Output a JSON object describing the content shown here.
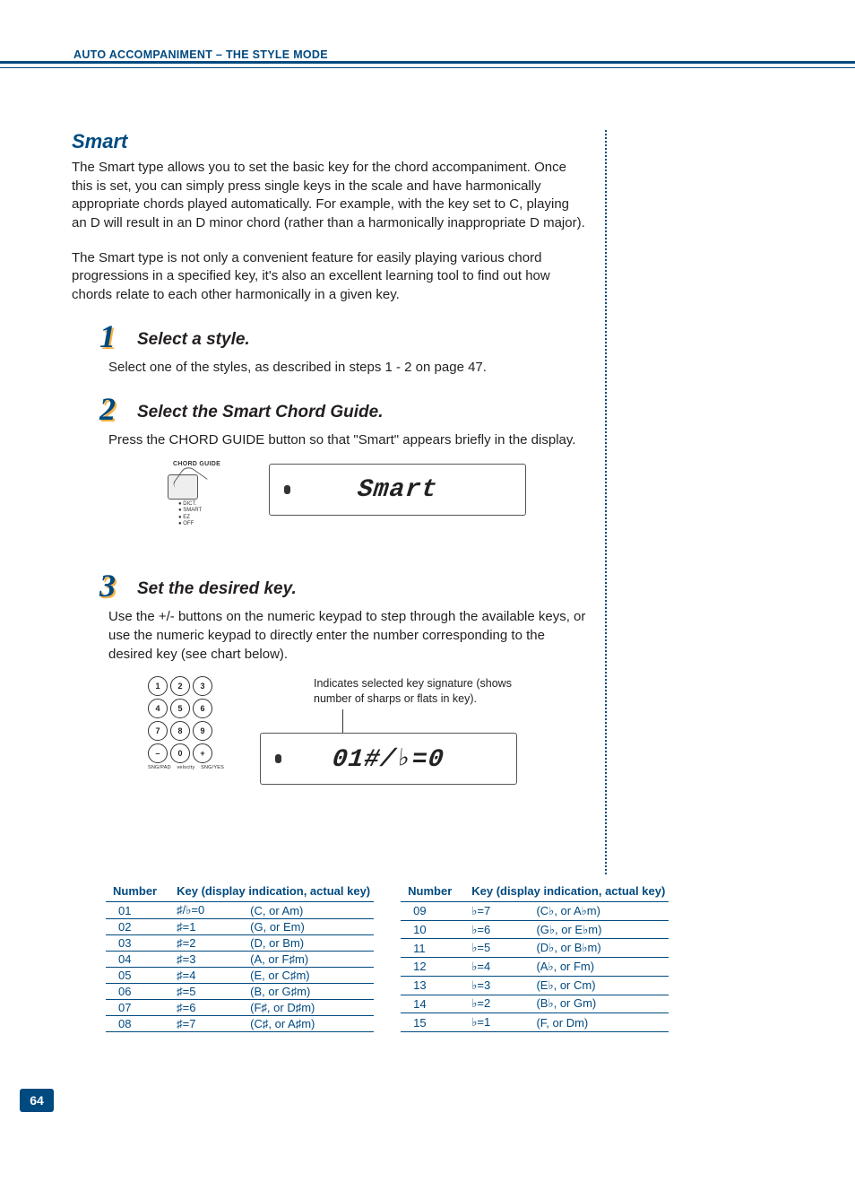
{
  "running_head": "AUTO ACCOMPANIMENT – THE STYLE MODE",
  "section_title": "Smart",
  "para1": "The Smart type allows you to set the basic key for the chord accompaniment.  Once this is set, you can simply press single keys in the scale and have harmonically appropriate chords played automatically.  For example, with the key set to C, playing an D will result in an D minor chord (rather than a harmonically inappropriate D major).",
  "para2": "The Smart type is not only a convenient feature for easily playing various chord progressions in a specified key, it's also an excellent learning tool to find out how chords relate to each other harmonically in a given key.",
  "steps": [
    {
      "num": "1",
      "title": "Select a style.",
      "body": "Select one of the styles, as described in steps 1 - 2 on page 47."
    },
    {
      "num": "2",
      "title": "Select the Smart Chord Guide.",
      "body": "Press the CHORD GUIDE button so that \"Smart\" appears briefly in the display."
    },
    {
      "num": "3",
      "title": "Set the desired key.",
      "body": "Use the +/- buttons on the numeric keypad to step through the available keys, or use the numeric keypad to directly enter the number corresponding to the desired key (see chart below)."
    }
  ],
  "chord_guide_btn": {
    "label": "CHORD GUIDE",
    "legend": [
      "DICT.",
      "SMART",
      "EZ",
      "OFF"
    ]
  },
  "lcd1": "Smart",
  "lcd2": "01#/♭=0",
  "keypad": {
    "keys": [
      "1",
      "2",
      "3",
      "4",
      "5",
      "6",
      "7",
      "8",
      "9",
      "–",
      "0",
      "+"
    ],
    "bottom_labels": [
      "SNG/PAD",
      "velocity",
      "SNG/YES"
    ]
  },
  "note_text": "Indicates selected key signature (shows number of sharps or flats in key).",
  "table_headers": {
    "number": "Number",
    "key": "Key (display indication, actual key)"
  },
  "table_left": [
    {
      "n": "01",
      "ind": "♯/♭=0",
      "act": "(C, or Am)"
    },
    {
      "n": "02",
      "ind": "♯=1",
      "act": "(G, or Em)"
    },
    {
      "n": "03",
      "ind": "♯=2",
      "act": "(D, or Bm)"
    },
    {
      "n": "04",
      "ind": "♯=3",
      "act": "(A, or F♯m)"
    },
    {
      "n": "05",
      "ind": "♯=4",
      "act": "(E, or C♯m)"
    },
    {
      "n": "06",
      "ind": "♯=5",
      "act": "(B, or G♯m)"
    },
    {
      "n": "07",
      "ind": "♯=6",
      "act": "(F♯, or D♯m)"
    },
    {
      "n": "08",
      "ind": "♯=7",
      "act": "(C♯, or A♯m)"
    }
  ],
  "table_right": [
    {
      "n": "09",
      "ind": "♭=7",
      "act": "(C♭, or A♭m)"
    },
    {
      "n": "10",
      "ind": "♭=6",
      "act": "(G♭, or E♭m)"
    },
    {
      "n": "11",
      "ind": "♭=5",
      "act": "(D♭, or B♭m)"
    },
    {
      "n": "12",
      "ind": "♭=4",
      "act": "(A♭, or Fm)"
    },
    {
      "n": "13",
      "ind": "♭=3",
      "act": "(E♭, or Cm)"
    },
    {
      "n": "14",
      "ind": "♭=2",
      "act": "(B♭, or Gm)"
    },
    {
      "n": "15",
      "ind": "♭=1",
      "act": "(F, or Dm)"
    }
  ],
  "page_number": "64"
}
